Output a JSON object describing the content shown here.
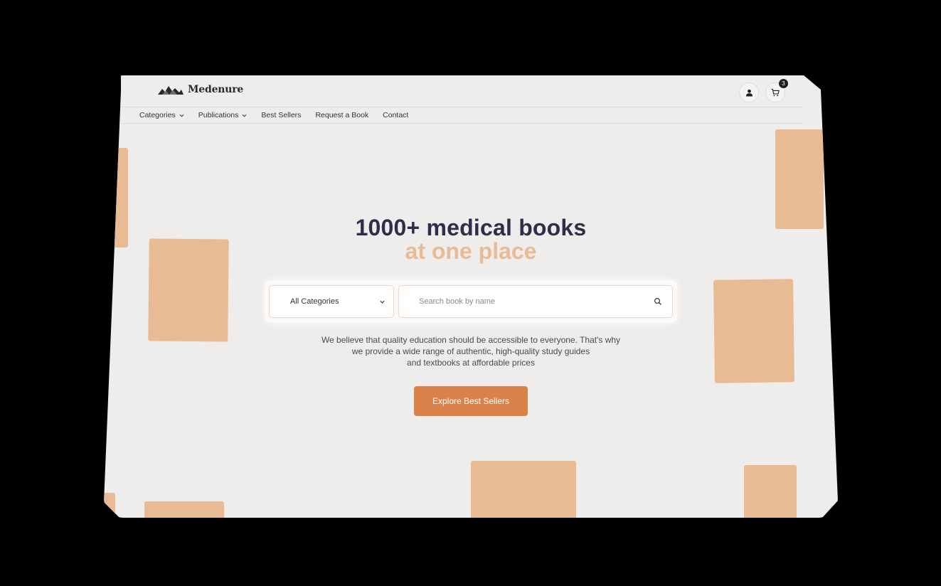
{
  "brand": {
    "name": "Medenure"
  },
  "header": {
    "cart_count": "3"
  },
  "nav": {
    "items": [
      {
        "label": "Categories",
        "has_dropdown": true
      },
      {
        "label": "Publications",
        "has_dropdown": true
      },
      {
        "label": "Best Sellers",
        "has_dropdown": false
      },
      {
        "label": "Request a Book",
        "has_dropdown": false
      },
      {
        "label": "Contact",
        "has_dropdown": false
      }
    ]
  },
  "hero": {
    "title": "1000+ medical books",
    "subtitle": "at one place",
    "description_lines": [
      "We believe that quality education should be accessible to everyone. That's why",
      "we provide a wide range of authentic, high-quality study guides",
      "and textbooks at affordable prices"
    ],
    "cta_label": "Explore Best Sellers"
  },
  "search": {
    "category_value": "All Categories",
    "placeholder": "Search book by name"
  },
  "colors": {
    "accent": "#d9834a",
    "peach": "#e8bb95",
    "title": "#2f2e48",
    "background": "#eeedeb"
  },
  "icons": [
    "logo-mark-icon",
    "user-icon",
    "cart-icon",
    "chevron-down-icon",
    "search-icon"
  ]
}
